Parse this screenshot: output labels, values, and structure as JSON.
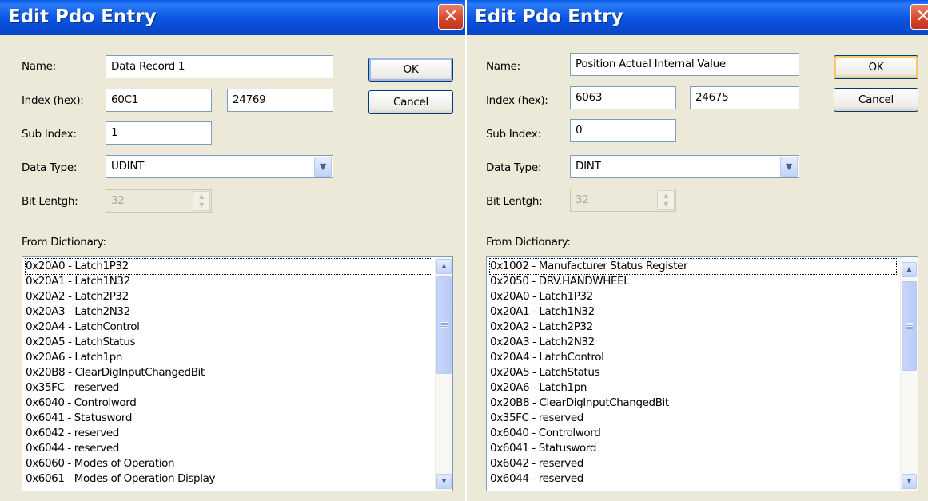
{
  "dialogs": [
    {
      "title": "Edit Pdo Entry",
      "close_glyph": "✕",
      "name_label": "Name:",
      "name_value": "Data Record 1",
      "index_label": "Index (hex):",
      "index_hex": "60C1",
      "index_dec": "24769",
      "subindex_label": "Sub Index:",
      "subindex_value": "1",
      "datatype_label": "Data Type:",
      "datatype_value": "UDINT",
      "bitlength_label": "Bit Lentgh:",
      "bitlength_value": "32",
      "ok_label": "OK",
      "cancel_label": "Cancel",
      "dictionary_label": "From Dictionary:",
      "dictionary_items": [
        "0x20A0 - Latch1P32",
        "0x20A1 - Latch1N32",
        "0x20A2 - Latch2P32",
        "0x20A3 - Latch2N32",
        "0x20A4 - LatchControl",
        "0x20A5 - LatchStatus",
        "0x20A6 - Latch1pn",
        "0x20B8 - ClearDigInputChangedBit",
        "0x35FC - reserved",
        "0x6040 - Controlword",
        "0x6041 - Statusword",
        "0x6042 - reserved",
        "0x6044 - reserved",
        "0x6060 - Modes of Operation",
        "0x6061 - Modes of Operation Display"
      ]
    },
    {
      "title": "Edit Pdo Entry",
      "close_glyph": "✕",
      "name_label": "Name:",
      "name_value": "Position Actual Internal Value",
      "index_label": "Index (hex):",
      "index_hex": "6063",
      "index_dec": "24675",
      "subindex_label": "Sub Index:",
      "subindex_value": "0",
      "datatype_label": "Data Type:",
      "datatype_value": "DINT",
      "bitlength_label": "Bit Lentgh:",
      "bitlength_value": "32",
      "ok_label": "OK",
      "cancel_label": "Cancel",
      "dictionary_label": "From Dictionary:",
      "dictionary_items": [
        "0x1002 - Manufacturer Status Register",
        "0x2050 - DRV.HANDWHEEL",
        "0x20A0 - Latch1P32",
        "0x20A1 - Latch1N32",
        "0x20A2 - Latch2P32",
        "0x20A3 - Latch2N32",
        "0x20A4 - LatchControl",
        "0x20A5 - LatchStatus",
        "0x20A6 - Latch1pn",
        "0x20B8 - ClearDigInputChangedBit",
        "0x35FC - reserved",
        "0x6040 - Controlword",
        "0x6041 - Statusword",
        "0x6042 - reserved",
        "0x6044 - reserved"
      ]
    }
  ],
  "icons": {
    "combo_arrow": "chevron-down-icon",
    "scroll_up": "scroll-up-icon",
    "scroll_down": "scroll-down-icon",
    "spin": "spin-updown-icon"
  },
  "colors": {
    "titlebar": "#0b54e0",
    "dialog_bg": "#ece9d8",
    "close_button": "#d9442a"
  }
}
